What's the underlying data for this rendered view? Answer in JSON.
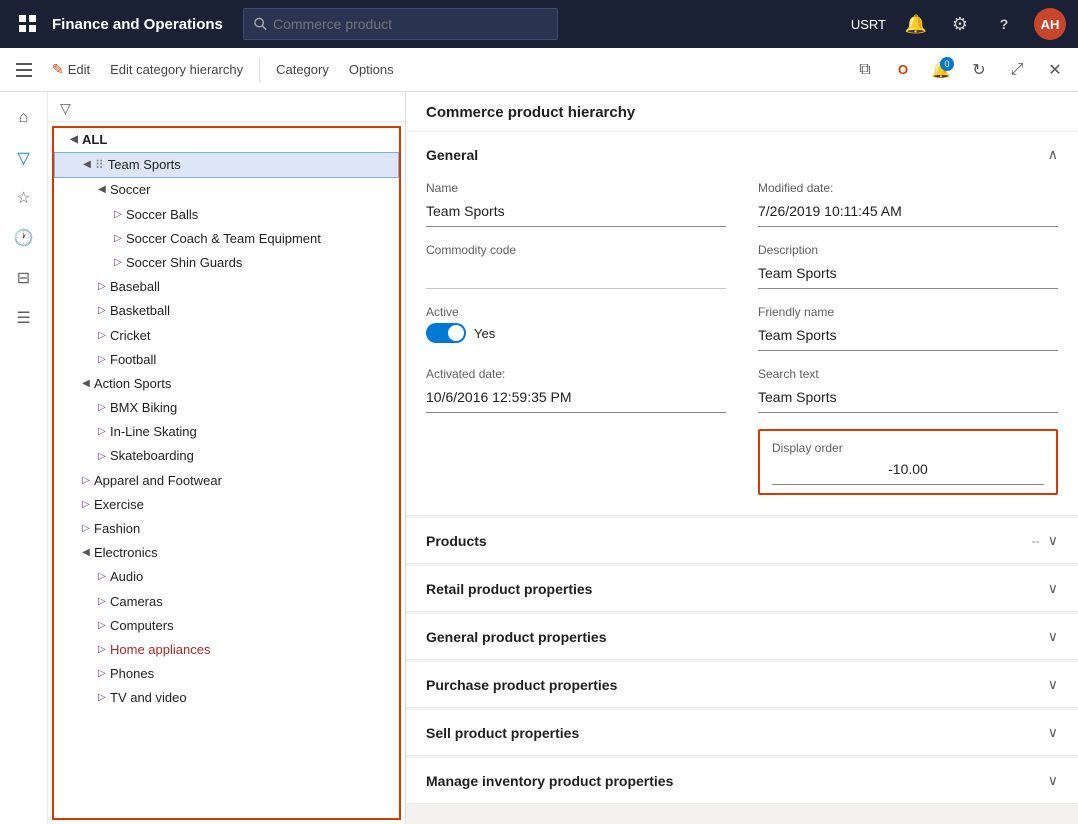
{
  "app": {
    "title": "Finance and Operations",
    "user": "USRT",
    "avatar": "AH",
    "search_placeholder": "Commerce product"
  },
  "toolbar": {
    "edit_label": "Edit",
    "edit_hierarchy_label": "Edit category hierarchy",
    "category_label": "Category",
    "options_label": "Options"
  },
  "detail": {
    "page_title": "Commerce product hierarchy",
    "general_section": "General",
    "products_section": "Products",
    "retail_section": "Retail product properties",
    "general_props_section": "General product properties",
    "purchase_section": "Purchase product properties",
    "sell_section": "Sell product properties",
    "manage_inventory_section": "Manage inventory product properties",
    "products_meta": "--",
    "fields": {
      "name_label": "Name",
      "name_value": "Team Sports",
      "modified_date_label": "Modified date:",
      "modified_date_value": "7/26/2019 10:11:45 AM",
      "commodity_code_label": "Commodity code",
      "commodity_code_value": "",
      "description_label": "Description",
      "description_value": "Team Sports",
      "active_label": "Active",
      "active_toggle": true,
      "active_text": "Yes",
      "friendly_name_label": "Friendly name",
      "friendly_name_value": "Team Sports",
      "activated_date_label": "Activated date:",
      "activated_date_value": "10/6/2016 12:59:35 PM",
      "search_text_label": "Search text",
      "search_text_value": "Team Sports",
      "display_order_label": "Display order",
      "display_order_value": "-10.00"
    }
  },
  "tree": {
    "root": "ALL",
    "items": [
      {
        "id": "team-sports",
        "label": "Team Sports",
        "level": 1,
        "expand": "collapse",
        "selected": true
      },
      {
        "id": "soccer",
        "label": "Soccer",
        "level": 2,
        "expand": "collapse"
      },
      {
        "id": "soccer-balls",
        "label": "Soccer Balls",
        "level": 3,
        "expand": "child"
      },
      {
        "id": "soccer-coach",
        "label": "Soccer Coach & Team Equipment",
        "level": 3,
        "expand": "child"
      },
      {
        "id": "soccer-shin",
        "label": "Soccer Shin Guards",
        "level": 3,
        "expand": "child"
      },
      {
        "id": "baseball",
        "label": "Baseball",
        "level": 2,
        "expand": "child"
      },
      {
        "id": "basketball",
        "label": "Basketball",
        "level": 2,
        "expand": "child"
      },
      {
        "id": "cricket",
        "label": "Cricket",
        "level": 2,
        "expand": "child"
      },
      {
        "id": "football",
        "label": "Football",
        "level": 2,
        "expand": "child"
      },
      {
        "id": "action-sports",
        "label": "Action Sports",
        "level": 1,
        "expand": "collapse"
      },
      {
        "id": "bmx",
        "label": "BMX Biking",
        "level": 2,
        "expand": "child"
      },
      {
        "id": "inline",
        "label": "In-Line Skating",
        "level": 2,
        "expand": "child"
      },
      {
        "id": "skateboarding",
        "label": "Skateboarding",
        "level": 2,
        "expand": "child"
      },
      {
        "id": "apparel",
        "label": "Apparel and Footwear",
        "level": 1,
        "expand": "child"
      },
      {
        "id": "exercise",
        "label": "Exercise",
        "level": 1,
        "expand": "child"
      },
      {
        "id": "fashion",
        "label": "Fashion",
        "level": 1,
        "expand": "child"
      },
      {
        "id": "electronics",
        "label": "Electronics",
        "level": 1,
        "expand": "collapse"
      },
      {
        "id": "audio",
        "label": "Audio",
        "level": 2,
        "expand": "child"
      },
      {
        "id": "cameras",
        "label": "Cameras",
        "level": 2,
        "expand": "child"
      },
      {
        "id": "computers",
        "label": "Computers",
        "level": 2,
        "expand": "child"
      },
      {
        "id": "home-appliances",
        "label": "Home appliances",
        "level": 2,
        "expand": "child"
      },
      {
        "id": "phones",
        "label": "Phones",
        "level": 2,
        "expand": "child"
      },
      {
        "id": "tv-video",
        "label": "TV and video",
        "level": 2,
        "expand": "child"
      }
    ]
  },
  "icons": {
    "grid": "⊞",
    "search": "🔍",
    "bell": "🔔",
    "gear": "⚙",
    "question": "?",
    "filter": "▽",
    "hamburger": "≡",
    "edit_pencil": "✎",
    "chevron_down": "∨",
    "chevron_up": "∧",
    "chevron_right": "▶",
    "collapse": "◀",
    "expand_right": "▷",
    "home": "⌂",
    "star": "☆",
    "clock": "🕐",
    "grid2": "⊟",
    "list": "☰",
    "close": "✕",
    "maximize": "⤢",
    "refresh": "↻",
    "puzzle": "⧉",
    "office": "Ο",
    "drag": "⠿"
  }
}
